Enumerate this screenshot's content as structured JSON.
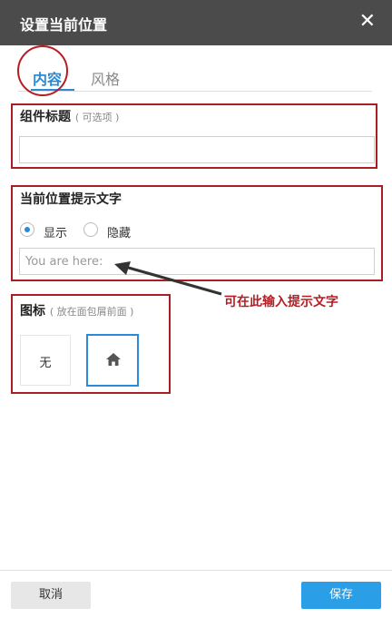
{
  "dialog": {
    "title": "设置当前位置",
    "close_icon": "close-icon"
  },
  "tabs": [
    {
      "label": "内容",
      "active": true
    },
    {
      "label": "风格",
      "active": false
    }
  ],
  "component_title": {
    "label": "组件标题",
    "hint": "( 可选项 )",
    "value": ""
  },
  "position_text": {
    "label": "当前位置提示文字",
    "options": [
      {
        "label": "显示",
        "checked": true
      },
      {
        "label": "隐藏",
        "checked": false
      }
    ],
    "placeholder": "You are here:"
  },
  "icon": {
    "label": "图标",
    "hint": "( 放在面包屑前面 )",
    "options": [
      {
        "label": "无",
        "selected": false
      },
      {
        "icon": "home-icon",
        "selected": true
      }
    ]
  },
  "annotation": "可在此输入提示文字",
  "footer": {
    "cancel_label": "取消",
    "save_label": "保存"
  },
  "colors": {
    "header_bg": "#4b4b4b",
    "accent": "#2a8ad8",
    "annotation": "#b81c22",
    "save_bg": "#2a9ee6"
  }
}
